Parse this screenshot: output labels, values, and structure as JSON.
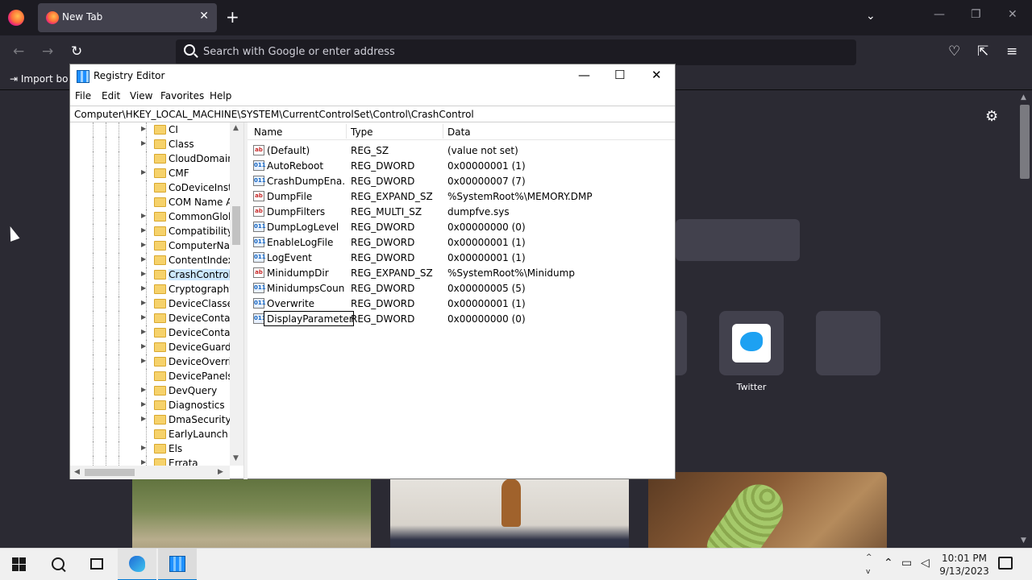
{
  "firefox": {
    "tab_title": "New Tab",
    "tab_close": "✕",
    "new_tab": "+",
    "tab_list": "⌄",
    "window_controls": {
      "minimize": "—",
      "restore": "❐",
      "close": "✕"
    },
    "nav": {
      "back": "←",
      "forward": "→",
      "reload": "↻",
      "pocket": "♡",
      "extensions": "⇱",
      "menu": "≡"
    },
    "url_placeholder": "Search with Google or enter address",
    "import_bookmarks": "Import bo",
    "settings": "⚙",
    "shortcut_twitter": "Twitter"
  },
  "regedit": {
    "title": "Registry Editor",
    "controls": {
      "minimize": "—",
      "maximize": "☐",
      "close": "✕"
    },
    "menu": [
      "File",
      "Edit",
      "View",
      "Favorites",
      "Help"
    ],
    "address": "Computer\\HKEY_LOCAL_MACHINE\\SYSTEM\\CurrentControlSet\\Control\\CrashControl",
    "tree": [
      {
        "label": "CI",
        "expandable": true
      },
      {
        "label": "Class",
        "expandable": true
      },
      {
        "label": "CloudDomainJoin",
        "expandable": false
      },
      {
        "label": "CMF",
        "expandable": true
      },
      {
        "label": "CoDeviceInstallers",
        "expandable": false
      },
      {
        "label": "COM Name Arbiter",
        "expandable": false
      },
      {
        "label": "CommonGlobUserSettings",
        "expandable": true
      },
      {
        "label": "Compatibility",
        "expandable": true
      },
      {
        "label": "ComputerName",
        "expandable": true
      },
      {
        "label": "ContentIndex",
        "expandable": true
      },
      {
        "label": "CrashControl",
        "expandable": true,
        "selected": true
      },
      {
        "label": "Cryptography",
        "expandable": true
      },
      {
        "label": "DeviceClasses",
        "expandable": true
      },
      {
        "label": "DeviceContainerPropertyUpdateEvents",
        "expandable": true
      },
      {
        "label": "DeviceContainers",
        "expandable": true
      },
      {
        "label": "DeviceGuard",
        "expandable": true
      },
      {
        "label": "DeviceOverrides",
        "expandable": true
      },
      {
        "label": "DevicePanels",
        "expandable": false
      },
      {
        "label": "DevQuery",
        "expandable": true
      },
      {
        "label": "Diagnostics",
        "expandable": true
      },
      {
        "label": "DmaSecurity",
        "expandable": true
      },
      {
        "label": "EarlyLaunch",
        "expandable": false
      },
      {
        "label": "Els",
        "expandable": true
      },
      {
        "label": "Errata",
        "expandable": true
      }
    ],
    "columns": {
      "name": "Name",
      "type": "Type",
      "data": "Data"
    },
    "values": [
      {
        "icon": "sz",
        "glyph": "ab",
        "name": "(Default)",
        "type": "REG_SZ",
        "data": "(value not set)"
      },
      {
        "icon": "dw",
        "glyph": "011",
        "name": "AutoReboot",
        "type": "REG_DWORD",
        "data": "0x00000001 (1)"
      },
      {
        "icon": "dw",
        "glyph": "011",
        "name": "CrashDumpEna...",
        "type": "REG_DWORD",
        "data": "0x00000007 (7)"
      },
      {
        "icon": "sz",
        "glyph": "ab",
        "name": "DumpFile",
        "type": "REG_EXPAND_SZ",
        "data": "%SystemRoot%\\MEMORY.DMP"
      },
      {
        "icon": "sz",
        "glyph": "ab",
        "name": "DumpFilters",
        "type": "REG_MULTI_SZ",
        "data": "dumpfve.sys"
      },
      {
        "icon": "dw",
        "glyph": "011",
        "name": "DumpLogLevel",
        "type": "REG_DWORD",
        "data": "0x00000000 (0)"
      },
      {
        "icon": "dw",
        "glyph": "011",
        "name": "EnableLogFile",
        "type": "REG_DWORD",
        "data": "0x00000001 (1)"
      },
      {
        "icon": "dw",
        "glyph": "011",
        "name": "LogEvent",
        "type": "REG_DWORD",
        "data": "0x00000001 (1)"
      },
      {
        "icon": "sz",
        "glyph": "ab",
        "name": "MinidumpDir",
        "type": "REG_EXPAND_SZ",
        "data": "%SystemRoot%\\Minidump"
      },
      {
        "icon": "dw",
        "glyph": "011",
        "name": "MinidumpsCount",
        "type": "REG_DWORD",
        "data": "0x00000005 (5)"
      },
      {
        "icon": "dw",
        "glyph": "011",
        "name": "Overwrite",
        "type": "REG_DWORD",
        "data": "0x00000001 (1)"
      },
      {
        "icon": "dw",
        "glyph": "011",
        "name": "DisplayParameters",
        "type": "REG_DWORD",
        "data": "0x00000000 (0)",
        "editing": true
      }
    ]
  },
  "taskbar": {
    "tray_up": "^",
    "tray_down": "v",
    "time": "10:01 PM",
    "date": "9/13/2023"
  }
}
